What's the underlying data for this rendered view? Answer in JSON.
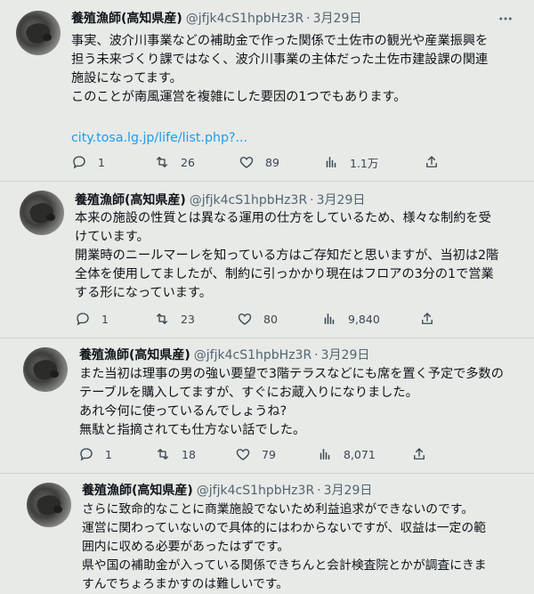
{
  "tweets": [
    {
      "author": "養殖漁師(高知県産)",
      "handle": "@jfjk4cS1hpbHz3R",
      "sep": "·",
      "date": "3月29日",
      "lines": [
        "事実、波介川事業などの補助金で作った関係で土佐市の観光や産業振興を",
        "担う未来づくり課ではなく、波介川事業の主体だった土佐市建設課の関連",
        "施設になってます。",
        "このことが南風運営を複雑にした要因の1つでもあります。"
      ],
      "link": "city.tosa.lg.jp/life/list.php?...",
      "replies": "1",
      "retweets": "26",
      "likes": "89",
      "views": "1.1万"
    },
    {
      "author": "養殖漁師(高知県産)",
      "handle": "@jfjk4cS1hpbHz3R",
      "sep": "·",
      "date": "3月29日",
      "lines": [
        "本来の施設の性質とは異なる運用の仕方をしているため、様々な制約を受",
        "けています。",
        "開業時のニールマーレを知っている方はご存知だと思いますが、当初は2階",
        "全体を使用してましたが、制約に引っかかり現在はフロアの3分の1で営業",
        "する形になっています。"
      ],
      "replies": "1",
      "retweets": "23",
      "likes": "80",
      "views": "9,840"
    },
    {
      "author": "養殖漁師(高知県産)",
      "handle": "@jfjk4cS1hpbHz3R",
      "sep": "·",
      "date": "3月29日",
      "lines": [
        "また当初は理事の男の強い要望で3階テラスなどにも席を置く予定で多数の",
        "テーブルを購入してますが、すぐにお蔵入りになりました。",
        "あれ今何に使っているんでしょうね?",
        "無駄と指摘されても仕方ない話でした。"
      ],
      "replies": "1",
      "retweets": "18",
      "likes": "79",
      "views": "8,071"
    },
    {
      "author": "養殖漁師(高知県産)",
      "handle": "@jfjk4cS1hpbHz3R",
      "sep": "·",
      "date": "3月29日",
      "lines": [
        "さらに致命的なことに商業施設でないため利益追求ができないのです。",
        "運営に関わっていないので具体的にはわからないですが、収益は一定の範",
        "囲内に収める必要があったはずです。",
        "県や国の補助金が入っている関係できちんと会計検査院とかが調査にきま",
        "すんでちょろまかすのは難しいです。"
      ]
    }
  ],
  "icons": {
    "reply": "reply-icon",
    "retweet": "retweet-icon",
    "like": "like-icon",
    "views": "views-icon",
    "share": "share-icon",
    "more": "more-icon"
  },
  "colors": {
    "background": "#e7eae7",
    "link": "#1d9bf0",
    "secondary_text": "#536471"
  }
}
